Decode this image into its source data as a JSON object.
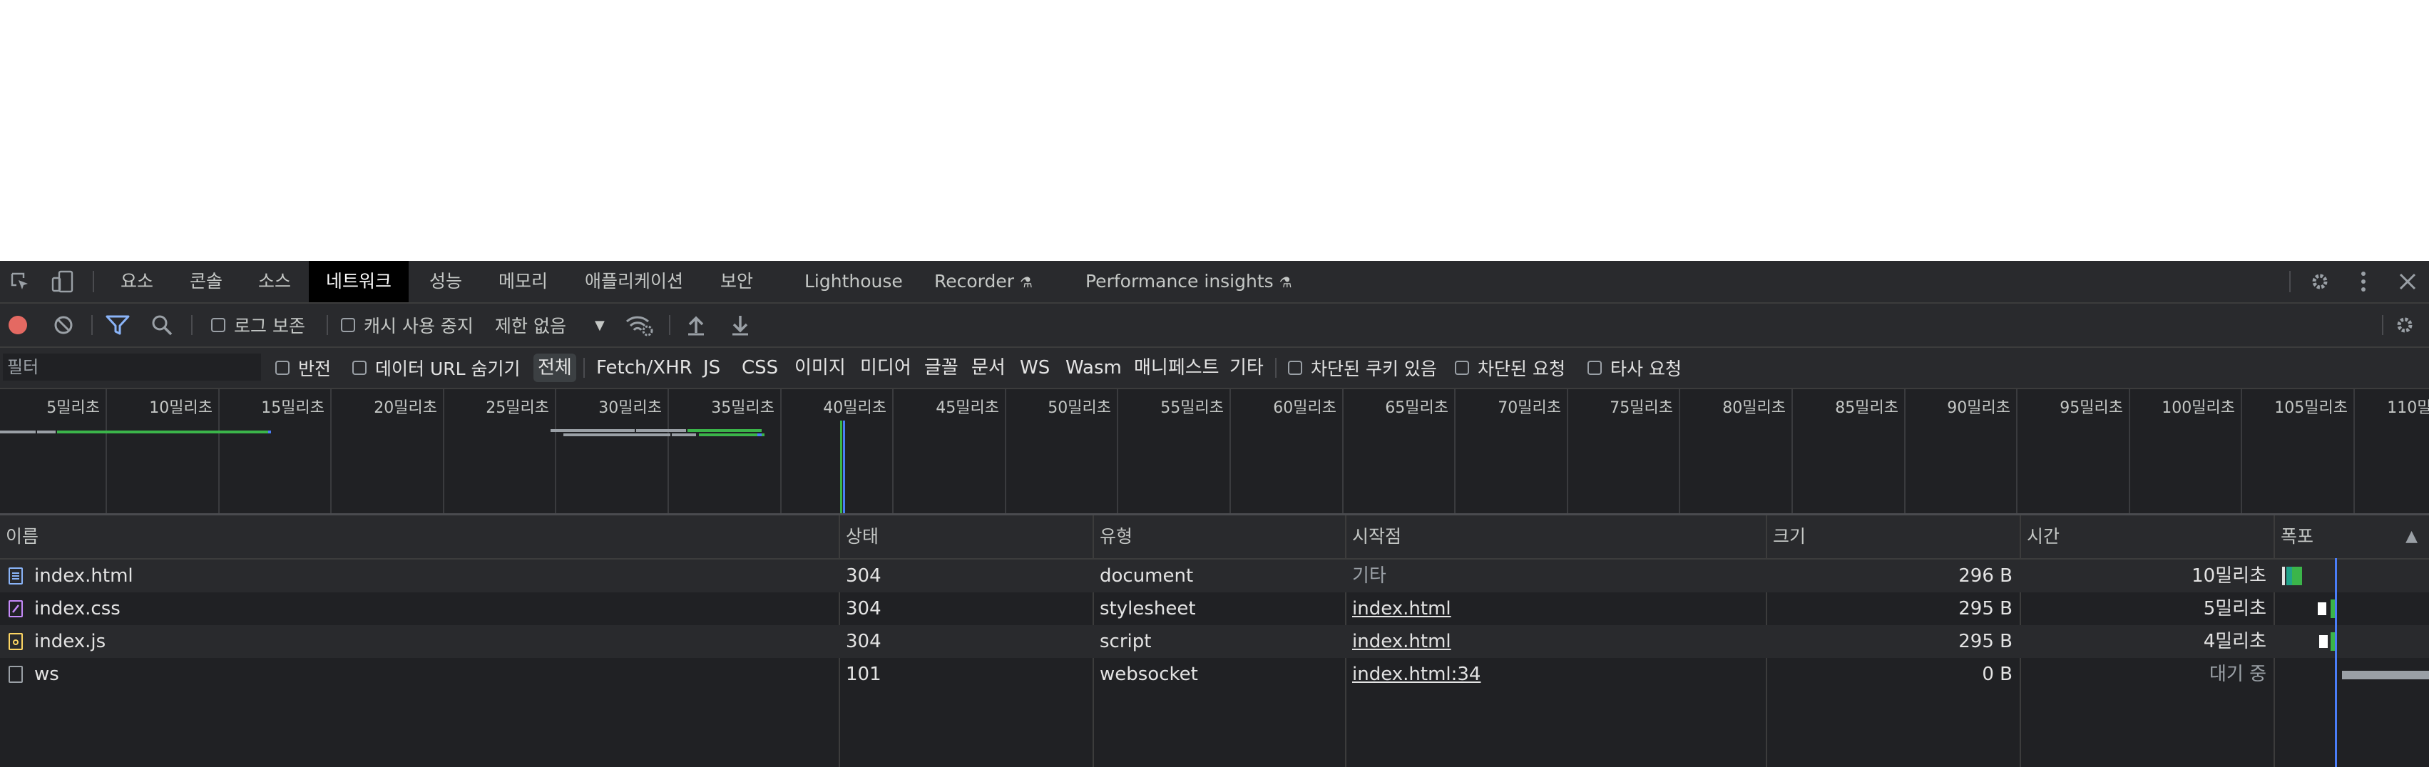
{
  "tabs": [
    {
      "label": "요소"
    },
    {
      "label": "콘솔"
    },
    {
      "label": "소스"
    },
    {
      "label": "네트워크"
    },
    {
      "label": "성능"
    },
    {
      "label": "메모리"
    },
    {
      "label": "애플리케이션"
    },
    {
      "label": "보안"
    },
    {
      "label": "Lighthouse"
    },
    {
      "label": "Recorder"
    },
    {
      "label": "Performance insights"
    }
  ],
  "toolbar": {
    "preserve_log": "로그 보존",
    "disable_cache": "캐시 사용 중지",
    "throttling": "제한 없음"
  },
  "filterbar": {
    "placeholder": "필터",
    "invert": "반전",
    "hide_data_urls": "데이터 URL 숨기기",
    "types": [
      "전체",
      "Fetch/XHR",
      "JS",
      "CSS",
      "이미지",
      "미디어",
      "글꼴",
      "문서",
      "WS",
      "Wasm",
      "매니페스트",
      "기타"
    ],
    "blocked_cookies": "차단된 쿠키 있음",
    "blocked_requests": "차단된 요청",
    "third_party": "타사 요청"
  },
  "overview": {
    "ticks": [
      "5밀리초",
      "10밀리초",
      "15밀리초",
      "20밀리초",
      "25밀리초",
      "30밀리초",
      "35밀리초",
      "40밀리초",
      "45밀리초",
      "50밀리초",
      "55밀리초",
      "60밀리초",
      "65밀리초",
      "70밀리초",
      "75밀리초",
      "80밀리초",
      "85밀리초",
      "90밀리초",
      "95밀리초",
      "100밀리초",
      "105밀리초",
      "110밀리초"
    ]
  },
  "table": {
    "headers": {
      "name": "이름",
      "status": "상태",
      "type": "유형",
      "initiator": "시작점",
      "size": "크기",
      "time": "시간",
      "waterfall": "폭포"
    },
    "rows": [
      {
        "name": "index.html",
        "status": "304",
        "type": "document",
        "initiator": "기타",
        "size": "296 B",
        "time": "10밀리초"
      },
      {
        "name": "index.css",
        "status": "304",
        "type": "stylesheet",
        "initiator": "index.html",
        "size": "295 B",
        "time": "5밀리초"
      },
      {
        "name": "index.js",
        "status": "304",
        "type": "script",
        "initiator": "index.html",
        "size": "295 B",
        "time": "4밀리초"
      },
      {
        "name": "ws",
        "status": "101",
        "type": "websocket",
        "initiator": "index.html:34",
        "size": "0 B",
        "time": "대기 중"
      }
    ]
  },
  "colors": {
    "accent_blue": "#4a7df7",
    "record_red": "#e46962",
    "bar_green": "#3bb54a",
    "bar_teal": "#21a38b"
  },
  "icons": [
    "inspect-icon",
    "device-toggle-icon",
    "settings-icon",
    "more-vert-icon",
    "close-icon",
    "record-icon",
    "clear-icon",
    "filter-icon",
    "search-icon",
    "network-conditions-icon",
    "upload-icon",
    "download-icon",
    "settings-icon-2",
    "flask-icon"
  ]
}
